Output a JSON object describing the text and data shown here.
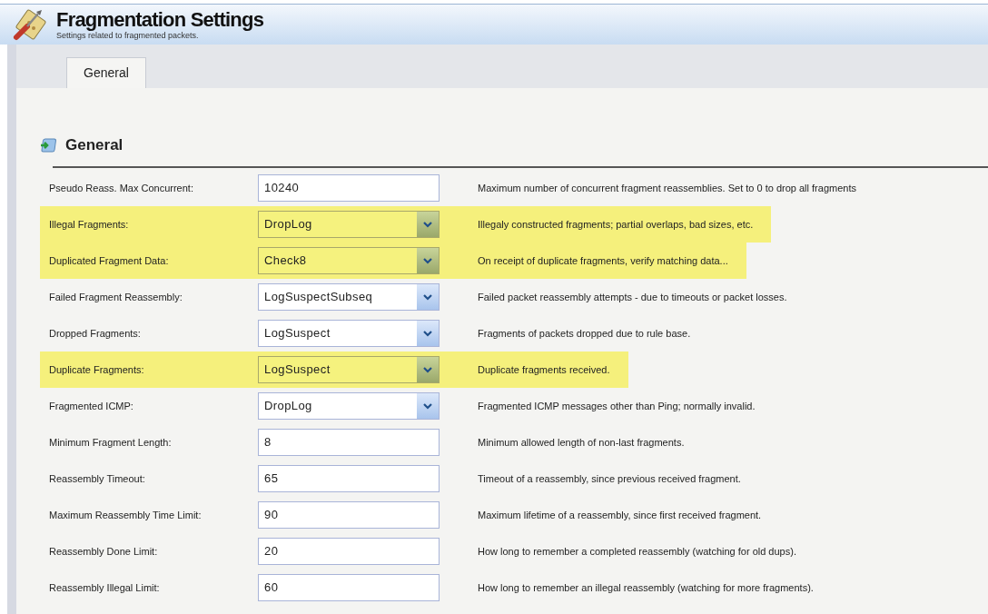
{
  "header": {
    "title": "Fragmentation Settings",
    "subtitle": "Settings related to fragmented packets."
  },
  "tabs": [
    {
      "label": "General",
      "selected": true
    }
  ],
  "section": {
    "title": "General"
  },
  "settings": [
    {
      "label": "Pseudo Reass. Max Concurrent:",
      "kind": "text",
      "value": "10240",
      "description": "Maximum number of concurrent fragment reassemblies. Set to 0 to drop all fragments",
      "highlighted": false
    },
    {
      "label": "Illegal Fragments:",
      "kind": "select",
      "value": "DropLog",
      "description": "Illegaly constructed fragments; partial overlaps, bad sizes, etc.",
      "highlighted": true
    },
    {
      "label": "Duplicated Fragment Data:",
      "kind": "select",
      "value": "Check8",
      "description": "On receipt of duplicate fragments, verify matching data...",
      "highlighted": true
    },
    {
      "label": "Failed Fragment Reassembly:",
      "kind": "select",
      "value": "LogSuspectSubseq",
      "description": "Failed packet reassembly attempts - due to timeouts or packet losses.",
      "highlighted": false
    },
    {
      "label": "Dropped Fragments:",
      "kind": "select",
      "value": "LogSuspect",
      "description": "Fragments of packets dropped due to rule base.",
      "highlighted": false
    },
    {
      "label": "Duplicate Fragments:",
      "kind": "select",
      "value": "LogSuspect",
      "description": "Duplicate fragments received.",
      "highlighted": true
    },
    {
      "label": "Fragmented ICMP:",
      "kind": "select",
      "value": "DropLog",
      "description": "Fragmented ICMP messages other than Ping; normally invalid.",
      "highlighted": false
    },
    {
      "label": "Minimum Fragment Length:",
      "kind": "text",
      "value": "8",
      "description": "Minimum allowed length of non-last fragments.",
      "highlighted": false
    },
    {
      "label": "Reassembly Timeout:",
      "kind": "text",
      "value": "65",
      "description": "Timeout of a reassembly, since previous received fragment.",
      "highlighted": false
    },
    {
      "label": "Maximum Reassembly Time Limit:",
      "kind": "text",
      "value": "90",
      "description": "Maximum lifetime of a reassembly, since first received fragment.",
      "highlighted": false
    },
    {
      "label": "Reassembly Done Limit:",
      "kind": "text",
      "value": "20",
      "description": "How long to remember a completed reassembly (watching for old dups).",
      "highlighted": false
    },
    {
      "label": "Reassembly Illegal Limit:",
      "kind": "text",
      "value": "60",
      "description": "How long to remember an illegal reassembly (watching for more fragments).",
      "highlighted": false
    }
  ]
}
